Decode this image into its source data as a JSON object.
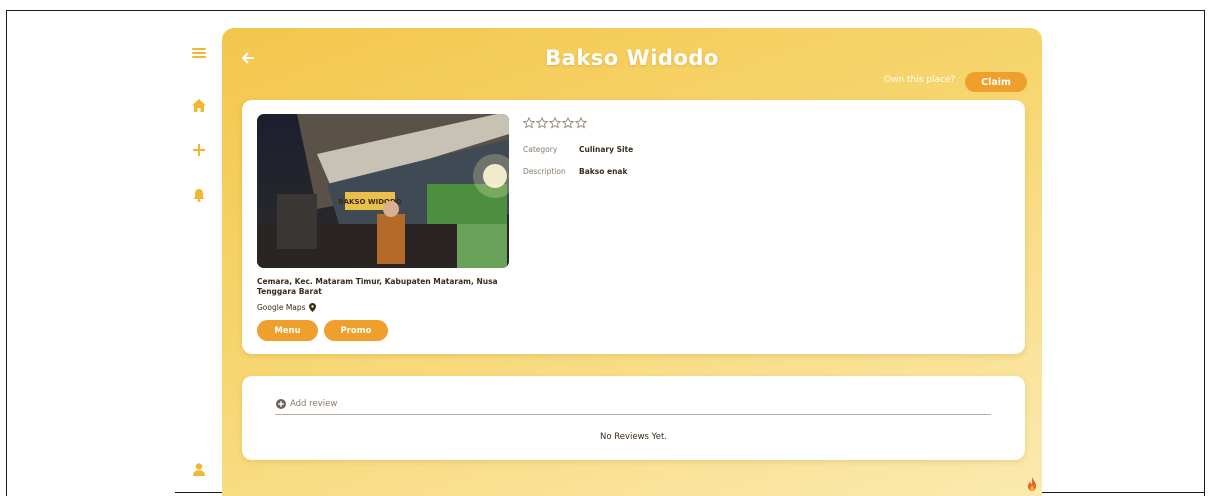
{
  "header": {
    "title": "Bakso Widodo",
    "own_prompt": "Own this place?",
    "claim_label": "Claim"
  },
  "sidebar": {
    "items": [
      {
        "icon": "hamburger-menu-icon"
      },
      {
        "icon": "home-icon"
      },
      {
        "icon": "plus-icon"
      },
      {
        "icon": "bell-icon"
      },
      {
        "icon": "user-icon"
      }
    ]
  },
  "place": {
    "photo_sign": "BAKSO WIDODO",
    "rating": 0,
    "rating_max": 5,
    "category_label": "Category",
    "category_value": "Culinary Site",
    "description_label": "Description",
    "description_value": "Bakso enak",
    "address": "Cemara, Kec. Mataram Timur, Kabupaten Mataram, Nusa Tenggara Barat",
    "maps_label": "Google Maps",
    "menu_label": "Menu",
    "promo_label": "Promo"
  },
  "reviews": {
    "placeholder": "Add review",
    "empty_text": "No Reviews Yet."
  },
  "colors": {
    "accent": "#ef9f2b",
    "panel_start": "#f3c64c",
    "panel_end": "#fbeab0",
    "sidebar_icon": "#f2b632"
  }
}
